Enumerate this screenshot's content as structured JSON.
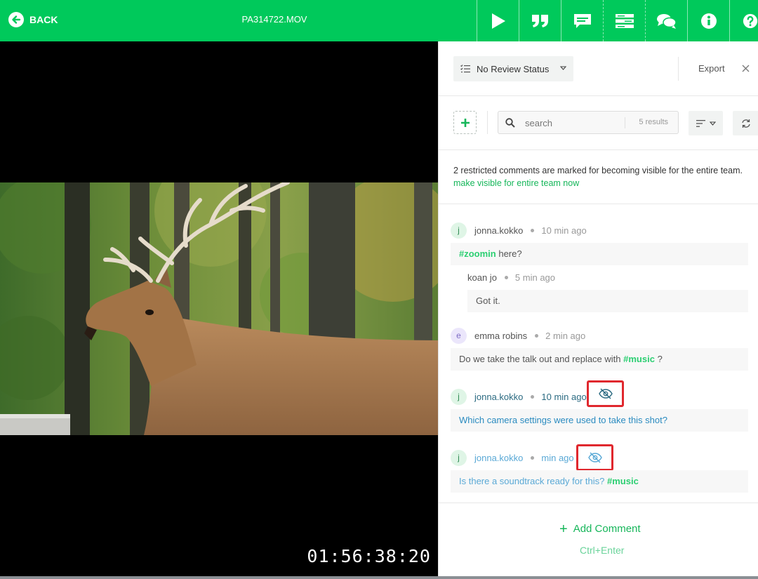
{
  "header": {
    "back_label": "BACK",
    "filename": "PA314722.MOV",
    "toolbar_icons": [
      "play-icon",
      "quote-icon",
      "comment-icon",
      "list-icon",
      "chat-icon",
      "info-icon",
      "help-icon"
    ]
  },
  "video": {
    "timecode": "01:56:38:20"
  },
  "panel": {
    "review_status": "No Review Status",
    "export_label": "Export",
    "search": {
      "placeholder": "search",
      "results": "5 results"
    },
    "notice": {
      "text": "2 restricted comments are marked for becoming visible for the entire team.",
      "link": "make visible for entire team now"
    },
    "comments": [
      {
        "user": "jonna.kokko",
        "initial": "j",
        "time": "10 min ago",
        "tag": "#zoomin",
        "text_after": " here?",
        "reply": {
          "user": "koan jo",
          "time": "5 min ago",
          "text": "Got it."
        }
      },
      {
        "user": "emma robins",
        "initial": "e",
        "time": "2 min ago",
        "text_before": "Do we take the talk out and replace with ",
        "tag": "#music",
        "text_after": " ?"
      },
      {
        "user": "jonna.kokko",
        "initial": "j",
        "time": "10 min ago",
        "text": "Which camera settings were used to take this shot?",
        "restricted": true
      },
      {
        "user": "jonna.kokko",
        "initial": "j",
        "time": "min ago",
        "text_before": "Is there a soundtrack ready for this? ",
        "tag": "#music",
        "restricted": true
      }
    ],
    "add_comment_label": "Add Comment",
    "shortcut_hint": "Ctrl+Enter"
  },
  "colors": {
    "brand_green": "#00c95b",
    "link_green": "#16b65a",
    "tag_green": "#2ccf72",
    "restricted_blue": "#2a8bc0",
    "highlight_red": "#e0282e"
  }
}
